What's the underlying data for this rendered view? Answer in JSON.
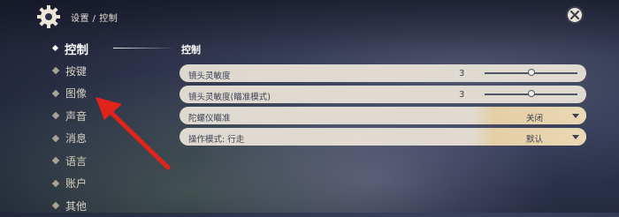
{
  "header": {
    "breadcrumb": "设置 / 控制",
    "icons": {
      "settings": "gear-icon",
      "close": "close-icon"
    }
  },
  "sidebar": {
    "items": [
      {
        "label": "控制",
        "active": true
      },
      {
        "label": "按键",
        "active": false
      },
      {
        "label": "图像",
        "active": false
      },
      {
        "label": "声音",
        "active": false
      },
      {
        "label": "消息",
        "active": false
      },
      {
        "label": "语言",
        "active": false
      },
      {
        "label": "账户",
        "active": false
      },
      {
        "label": "其他",
        "active": false
      }
    ]
  },
  "main": {
    "section_title": "控制",
    "rows": [
      {
        "label": "镜头灵敏度",
        "value": "3",
        "slider_fraction": 0.5
      },
      {
        "label": "镜头灵敏度(瞄准模式)",
        "value": "3",
        "slider_fraction": 0.5
      },
      {
        "label": "陀螺仪瞄准",
        "selected": "关闭"
      },
      {
        "label": "操作模式: 行走",
        "selected": "默认"
      }
    ]
  },
  "annotation": {
    "arrow_color": "#e0241b",
    "icon": "red-arrow-icon"
  },
  "colors": {
    "row_bg": "#ece5d8",
    "text_dark": "#3b4255",
    "dropdown_accent": "#e9d8b2"
  }
}
